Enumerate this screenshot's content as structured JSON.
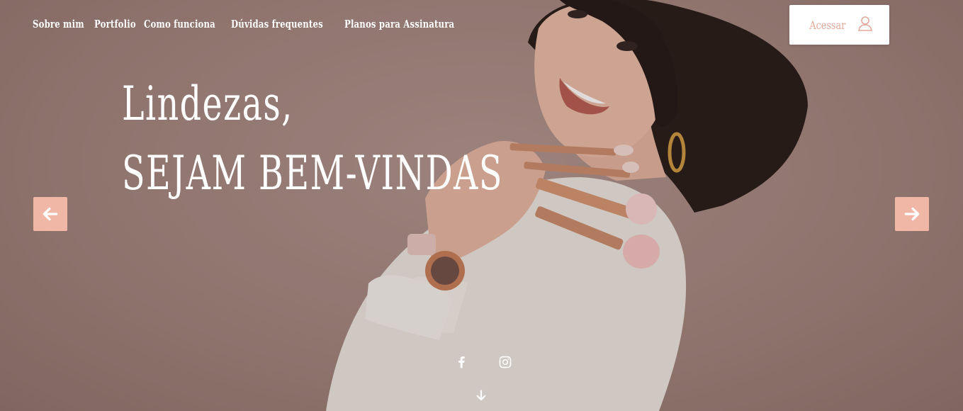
{
  "nav": {
    "items": [
      {
        "label": "Sobre mim"
      },
      {
        "label": "Portfolio"
      },
      {
        "label": "Como funciona"
      },
      {
        "label": "Dúvidas frequentes"
      },
      {
        "label": "Planos para Assinatura"
      }
    ]
  },
  "login": {
    "label": "Acessar",
    "icon": "user-icon"
  },
  "hero": {
    "line1": "Lindezas,",
    "line2": "sejam bem-vindas"
  },
  "carousel": {
    "prev_icon": "arrow-left-icon",
    "next_icon": "arrow-right-icon"
  },
  "social": {
    "icons": [
      "facebook-icon",
      "instagram-icon"
    ],
    "scroll_icon": "arrow-down-icon"
  },
  "colors": {
    "background": "#a48680",
    "accent": "#f1b7a6",
    "login_text": "#e3a89a",
    "text": "#ffffff"
  }
}
